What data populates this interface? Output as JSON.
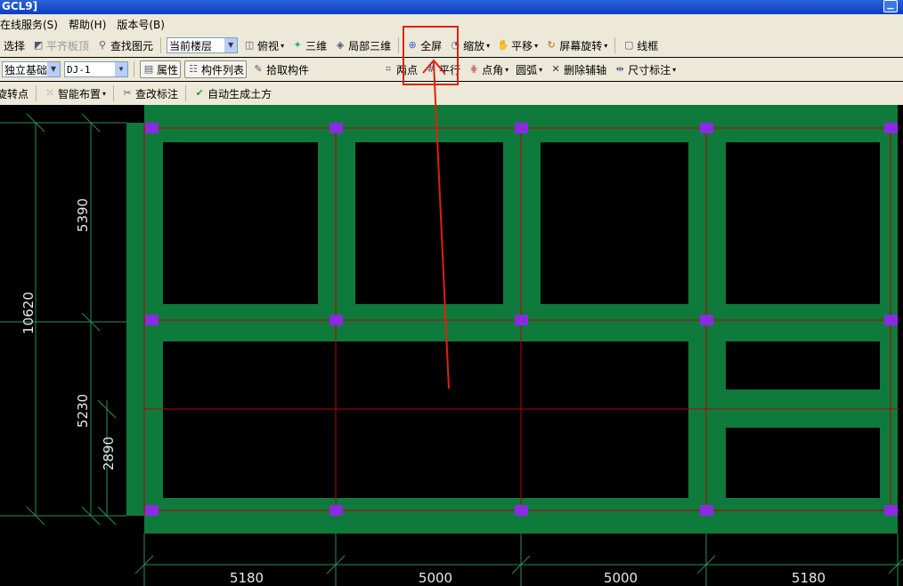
{
  "title": "GCL9]",
  "menu": [
    "在线服务(S)",
    "帮助(H)",
    "版本号(B)"
  ],
  "toolbar1": {
    "select": "选择",
    "align_top": "平齐板顶",
    "find": "查找图元",
    "floor_select": "当前楼层",
    "top_view": "俯视",
    "three_d": "三维",
    "local_3d": "局部三维",
    "full_screen": "全屏",
    "zoom": "缩放",
    "pan": "平移",
    "rotate": "屏幕旋转",
    "wireframe": "线框"
  },
  "toolbar2": {
    "type_select": "独立基础",
    "component_select": "DJ-1",
    "properties": "属性",
    "component_list": "构件列表",
    "pick": "拾取构件",
    "two_points": "两点",
    "parallel": "平行",
    "point_angle": "点角",
    "arc": "圆弧",
    "delete_axis": "删除辅轴",
    "dimension": "尺寸标注"
  },
  "toolbar3": {
    "rotate_point": "旋转点",
    "smart_layout": "智能布置",
    "edit_label": "查改标注",
    "auto_earthwork": "自动生成土方"
  },
  "drawing": {
    "left_dims": {
      "total": "10620",
      "upper": "5390",
      "lower": "5230",
      "sub": "2890"
    },
    "bottom_dims": [
      "5180",
      "5000",
      "5000",
      "5180"
    ],
    "colors": {
      "beam": "#0e7a3c",
      "axis": "#c00000",
      "column": "#8a2be2",
      "annotation": "#e02010"
    }
  }
}
